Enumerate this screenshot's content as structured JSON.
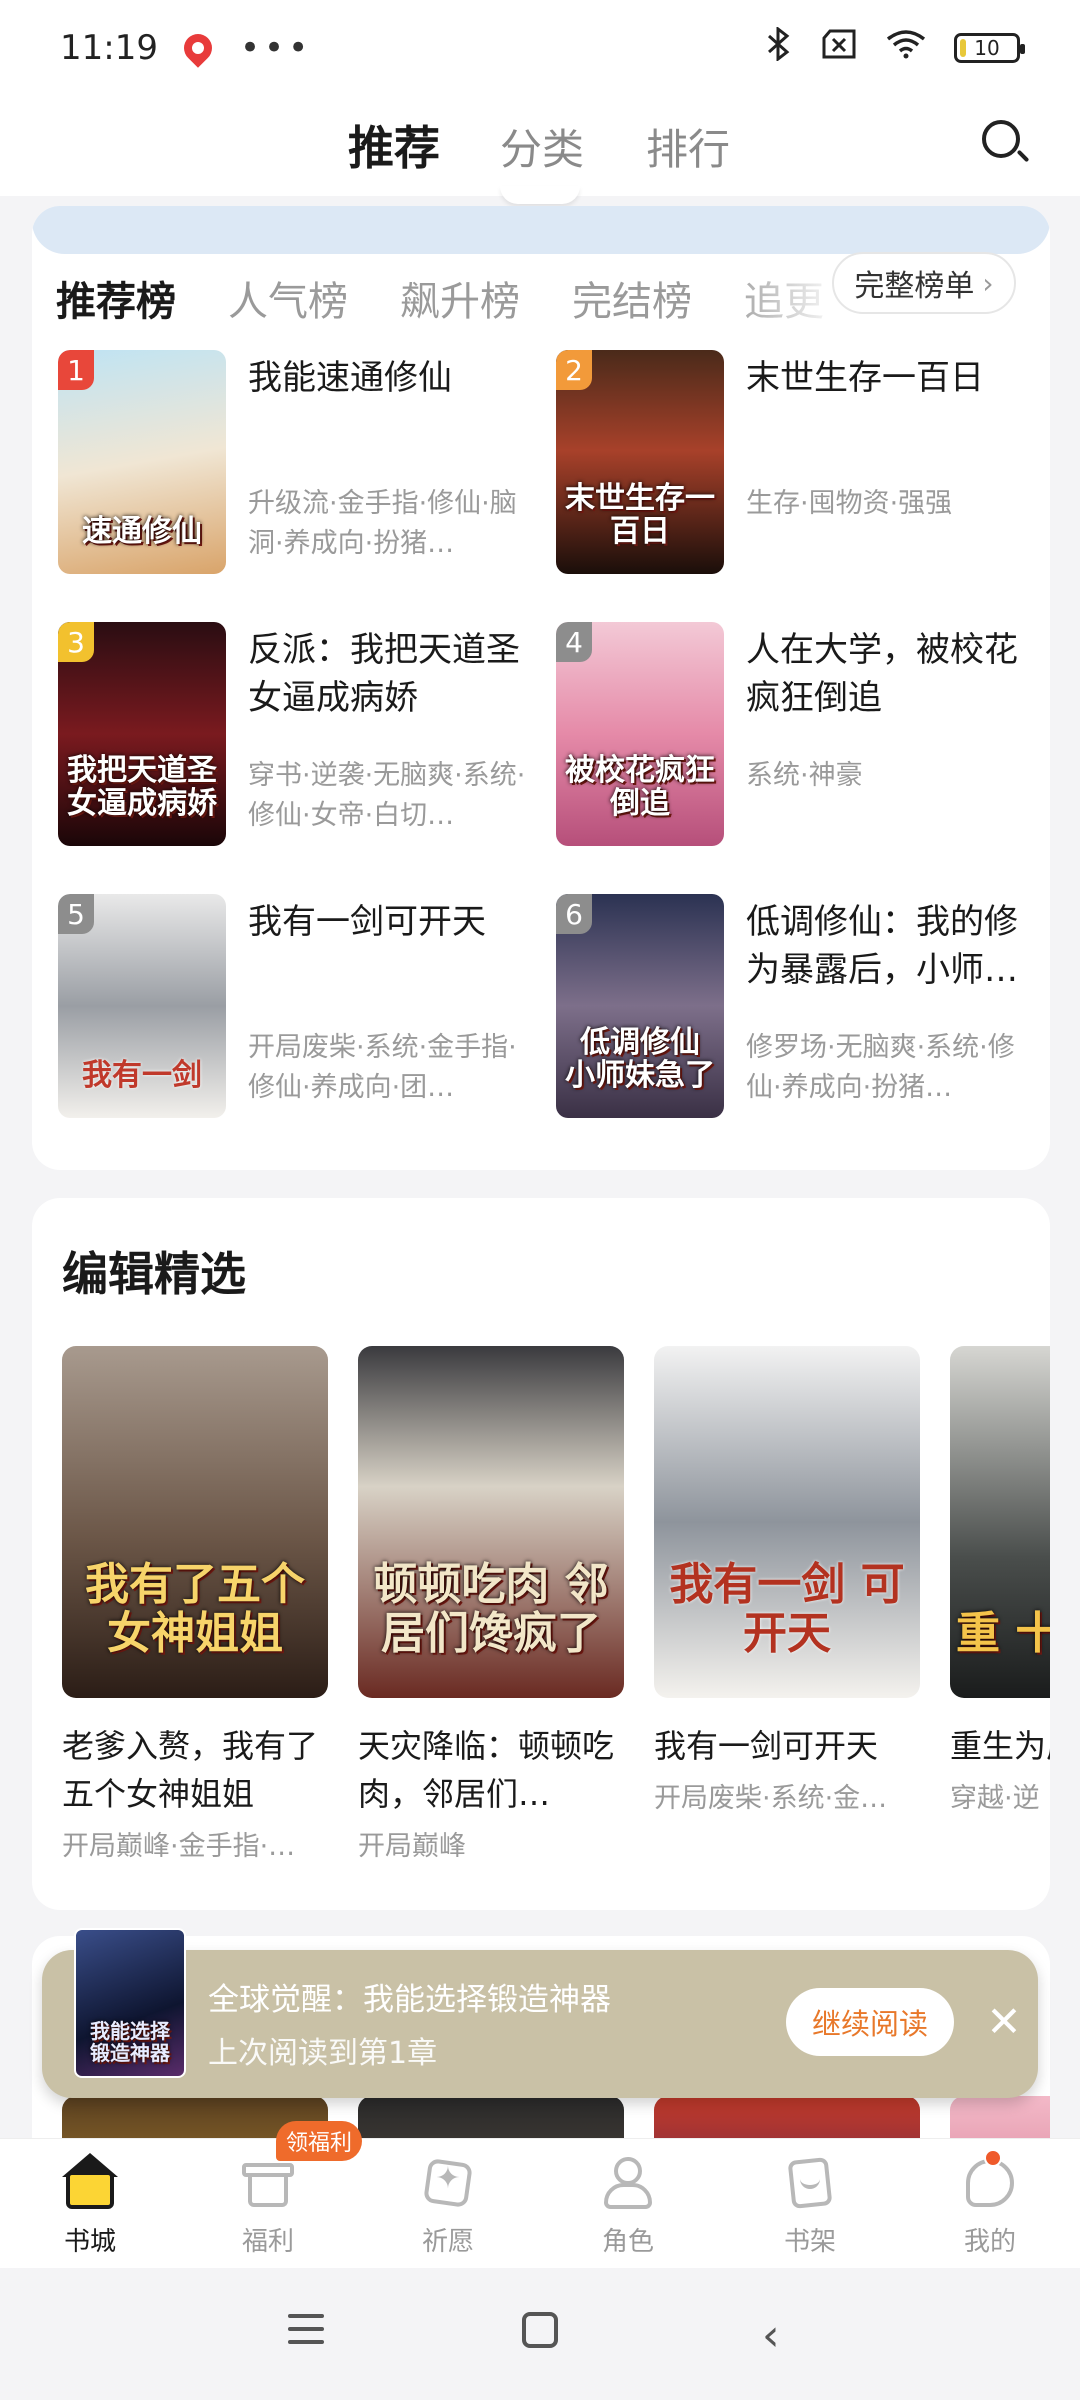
{
  "status_bar": {
    "time": "11:19",
    "dots": "•••",
    "bluetooth_icon": "bluetooth-icon",
    "sim_icon": "no-sim-icon",
    "wifi_icon": "wifi-icon",
    "battery": "10"
  },
  "top_nav": {
    "tabs": [
      {
        "label": "推荐",
        "active": true
      },
      {
        "label": "分类",
        "active": false
      },
      {
        "label": "排行",
        "active": false
      }
    ],
    "search_icon": "search-icon"
  },
  "rank": {
    "tabs": [
      "推荐榜",
      "人气榜",
      "飙升榜",
      "完结榜",
      "追更"
    ],
    "full_rank_label": "完整榜单",
    "full_rank_chevron": "›",
    "items": [
      {
        "rank": "1",
        "title": "我能速通修仙",
        "cover_text": "速通修仙",
        "tags": "升级流·金手指·修仙·脑洞·养成向·扮猪…"
      },
      {
        "rank": "2",
        "title": "末世生存一百日",
        "cover_text": "末世生存一百日",
        "tags": "生存·囤物资·强强"
      },
      {
        "rank": "3",
        "title": "反派：我把天道圣女逼成病娇",
        "cover_text": "我把天道圣女逼成病娇",
        "tags": "穿书·逆袭·无脑爽·系统·修仙·女帝·白切…"
      },
      {
        "rank": "4",
        "title": "人在大学，被校花疯狂倒追",
        "cover_text": "被校花疯狂倒追",
        "tags": "系统·神豪"
      },
      {
        "rank": "5",
        "title": "我有一剑可开天",
        "cover_text": "我有一剑",
        "tags": "开局废柴·系统·金手指·修仙·养成向·团…"
      },
      {
        "rank": "6",
        "title": "低调修仙：我的修为暴露后，小师…",
        "cover_text": "低调修仙 小师妹急了",
        "tags": "修罗场·无脑爽·系统·修仙·养成向·扮猪…"
      }
    ]
  },
  "editor_picks": {
    "title": "编辑精选",
    "items": [
      {
        "title": "老爹入赘，我有了五个女神姐姐",
        "cover_text": "我有了五个女神姐姐",
        "tags": "开局巅峰·金手指·…"
      },
      {
        "title": "天灾降临：顿顿吃肉，邻居们…",
        "cover_text": "顿顿吃肉 邻居们馋疯了",
        "tags": "开局巅峰"
      },
      {
        "title": "我有一剑可开天",
        "cover_text": "我有一剑 可开天",
        "tags": "开局废柴·系统·金…"
      },
      {
        "title": "重生为成蛟，",
        "cover_text": "重 十",
        "tags": "穿越·逆"
      }
    ]
  },
  "continue_reading": {
    "title": "全球觉醒：我能选择锻造神器",
    "subtitle": "上次阅读到第1章",
    "cover_text": "我能选择锻造神器",
    "button": "继续阅读",
    "close": "✕"
  },
  "tab_bar": {
    "welfare_badge": "领福利",
    "items": [
      {
        "label": "书城",
        "icon": "bookstore-icon",
        "active": true
      },
      {
        "label": "福利",
        "icon": "gift-icon",
        "active": false
      },
      {
        "label": "祈愿",
        "icon": "wish-card-icon",
        "active": false
      },
      {
        "label": "角色",
        "icon": "character-icon",
        "active": false
      },
      {
        "label": "书架",
        "icon": "bookshelf-icon",
        "active": false
      },
      {
        "label": "我的",
        "icon": "profile-icon",
        "active": false
      }
    ]
  },
  "colors": {
    "accent_yellow": "#fbe26b",
    "rank_1": "#e8473a",
    "rank_2": "#f29a3a",
    "rank_3": "#f2c12e",
    "rank_other": "#8d8d8d",
    "continue_button_text": "#e8782a",
    "continue_bar_bg": "#c9c1a6"
  }
}
